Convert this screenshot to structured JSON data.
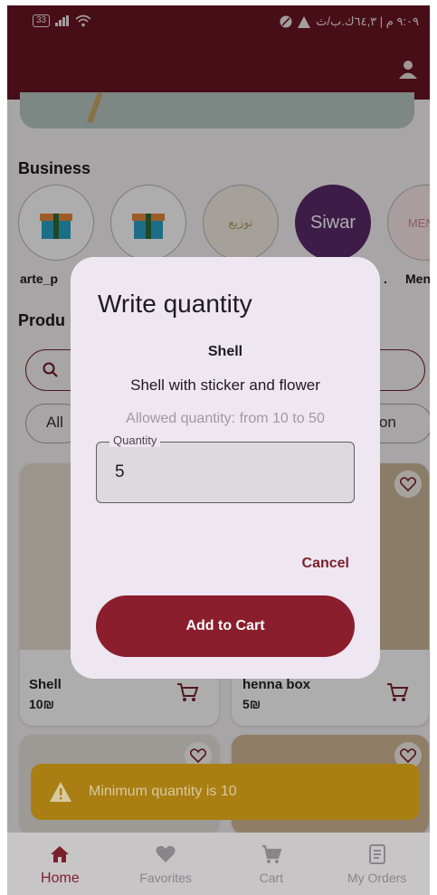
{
  "status_bar": {
    "battery": "33",
    "right_text": "٩:٠٩ م | ٦٤,٣ك.ب/ث"
  },
  "sections": {
    "business_title": "Business",
    "products_title": "Produ"
  },
  "business": [
    {
      "label": "arte_p",
      "logo_text": "Present Box"
    },
    {
      "label": "",
      "logo_text": "Present Box"
    },
    {
      "label": "",
      "logo_text": "توزيع"
    },
    {
      "label": ".",
      "logo_text": "Siwar"
    },
    {
      "label": "Men",
      "logo_text": "MENU"
    }
  ],
  "chips": {
    "first": "All",
    "last": "ution"
  },
  "products": [
    {
      "name": "Shell",
      "price": "10₪"
    },
    {
      "name": "henna box",
      "price": "5₪"
    }
  ],
  "dialog": {
    "title": "Write quantity",
    "product_name": "Shell",
    "description": "Shell with sticker and flower",
    "allowed_text": "Allowed quantity: from 10 to 50",
    "quantity_label": "Quantity",
    "quantity_value": "5",
    "cancel_label": "Cancel",
    "add_label": "Add to Cart"
  },
  "toast": {
    "message": "Minimum quantity is 10"
  },
  "bottom_nav": {
    "items": [
      {
        "label": "Home",
        "icon": "home-icon"
      },
      {
        "label": "Favorites",
        "icon": "heart-icon"
      },
      {
        "label": "Cart",
        "icon": "cart-icon"
      },
      {
        "label": "My Orders",
        "icon": "orders-icon"
      }
    ]
  },
  "colors": {
    "primary": "#6a1623",
    "accent_button": "#8b1e2c",
    "toast": "#a97f13",
    "dialog_bg": "#eee7f1"
  }
}
